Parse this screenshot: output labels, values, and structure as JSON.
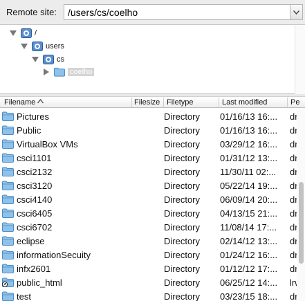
{
  "remote_site": {
    "label": "Remote site:",
    "path": "/users/cs/coelho"
  },
  "tree": {
    "nodes": [
      {
        "label": "/",
        "expanded": true
      },
      {
        "label": "users",
        "expanded": true
      },
      {
        "label": "cs",
        "expanded": true
      },
      {
        "label": "coelho",
        "expanded": false,
        "selected": true
      }
    ]
  },
  "table": {
    "columns": {
      "filename": "Filename",
      "filesize": "Filesize",
      "filetype": "Filetype",
      "last_modified": "Last modified",
      "permissions": "Pe"
    },
    "rows": [
      {
        "name": "Pictures",
        "size": "",
        "type": "Directory",
        "modified": "01/16/13 16:...",
        "perm": "dr",
        "icon": "folder-icon"
      },
      {
        "name": "Public",
        "size": "",
        "type": "Directory",
        "modified": "01/16/13 16:...",
        "perm": "dr",
        "icon": "folder-icon"
      },
      {
        "name": "VirtualBox VMs",
        "size": "",
        "type": "Directory",
        "modified": "03/29/12 16:...",
        "perm": "dr",
        "icon": "folder-icon"
      },
      {
        "name": "csci1101",
        "size": "",
        "type": "Directory",
        "modified": "01/31/12 13:...",
        "perm": "dr",
        "icon": "folder-icon"
      },
      {
        "name": "csci2132",
        "size": "",
        "type": "Directory",
        "modified": "11/30/11 02:...",
        "perm": "dr",
        "icon": "folder-icon"
      },
      {
        "name": "csci3120",
        "size": "",
        "type": "Directory",
        "modified": "05/22/14 19:...",
        "perm": "dr",
        "icon": "folder-icon"
      },
      {
        "name": "csci4140",
        "size": "",
        "type": "Directory",
        "modified": "06/09/14 20:...",
        "perm": "dr",
        "icon": "folder-icon"
      },
      {
        "name": "csci6405",
        "size": "",
        "type": "Directory",
        "modified": "04/13/15 21:...",
        "perm": "dr",
        "icon": "folder-icon"
      },
      {
        "name": "csci6702",
        "size": "",
        "type": "Directory",
        "modified": "11/08/14 17:...",
        "perm": "dr",
        "icon": "folder-icon"
      },
      {
        "name": "eclipse",
        "size": "",
        "type": "Directory",
        "modified": "02/14/12 13:...",
        "perm": "dr",
        "icon": "folder-icon"
      },
      {
        "name": "informationSecuity",
        "size": "",
        "type": "Directory",
        "modified": "01/24/12 16:...",
        "perm": "dr",
        "icon": "folder-icon"
      },
      {
        "name": "infx2601",
        "size": "",
        "type": "Directory",
        "modified": "01/12/12 17:...",
        "perm": "dr",
        "icon": "folder-icon"
      },
      {
        "name": "public_html",
        "size": "",
        "type": "Directory",
        "modified": "06/25/12 14:...",
        "perm": "lrw",
        "icon": "folder-link-icon"
      },
      {
        "name": "test",
        "size": "",
        "type": "Directory",
        "modified": "03/23/15 18:...",
        "perm": "dr",
        "icon": "folder-icon"
      }
    ]
  },
  "colors": {
    "folder": "#5a9fd6",
    "selection": "#d5d5d5",
    "header_bg": "#ececec"
  }
}
